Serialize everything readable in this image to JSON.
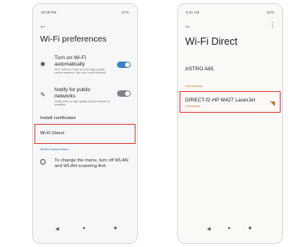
{
  "screen_left": {
    "status": {
      "time": "10:08 PM",
      "battery": "67%"
    },
    "title": "Wi-Fi preferences",
    "items": [
      {
        "title": "Turn on Wi-Fi automatically",
        "subtitle": "Wi-Fi will turn back on near high-quality saved networks, like your home network",
        "toggle": "on",
        "icon": "wifi-auto-icon"
      },
      {
        "title": "Notify for public networks",
        "subtitle": "Notify when a high-quality public network is available",
        "toggle": "off",
        "icon": "wifi-notify-icon"
      }
    ],
    "install_certificates": "Install certificates",
    "wifi_direct": "Wi-Fi Direct",
    "wlan_menu_header": "WLAN Custom Menu",
    "info_text": "To change the menu, turn off WLAN and WLAN scanning first.",
    "nav": {
      "back": "◀",
      "home": "●",
      "recent": "■"
    }
  },
  "screen_right": {
    "status": {
      "time": "6:31 AM",
      "battery": "62%"
    },
    "title": "Wi-Fi Direct",
    "device_name": "ASTRO A65",
    "peer_header": "Peer devices",
    "peer": {
      "name": "DIRECT-f2-HP M427 LaserJet",
      "status": "Connected"
    },
    "nav": {
      "back": "◀",
      "home": "●",
      "recent": "■"
    }
  },
  "colors": {
    "highlight": "#e53935",
    "toggle_on": "#3a80c8",
    "accent_blue": "#1e62b5",
    "accent_orange": "#b8732e"
  }
}
